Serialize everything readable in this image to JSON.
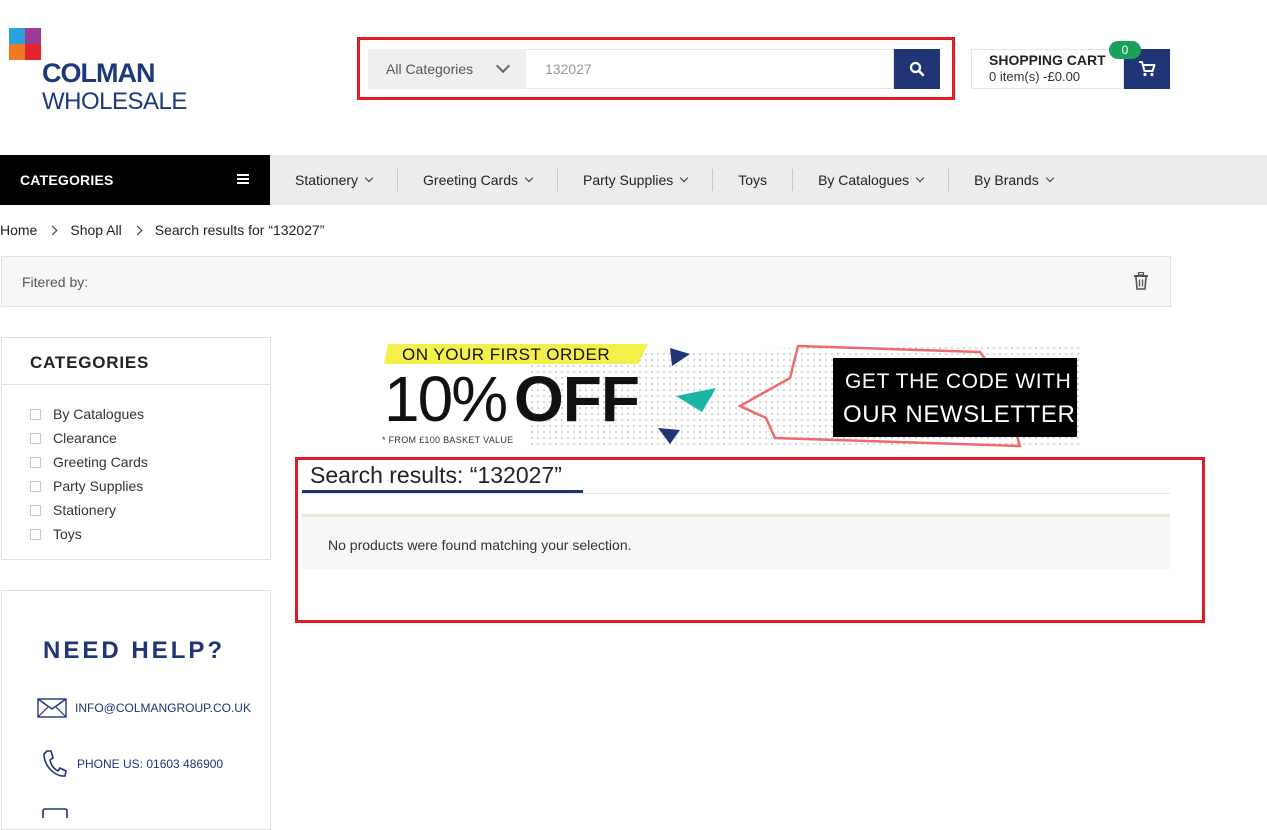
{
  "brand": {
    "line1": "COLMAN",
    "line2": "WHOLESALE",
    "colors": [
      "#2aa3dc",
      "#9b3d97",
      "#f07a21",
      "#e3262e",
      "#1c3a7a"
    ]
  },
  "search": {
    "category_selected": "All Categories",
    "query": "132027",
    "button_icon": "search-icon"
  },
  "cart": {
    "title": "SHOPPING CART",
    "summary": "0 item(s) -£0.00",
    "count": "0",
    "icon": "cart-icon"
  },
  "nav": {
    "categories_label": "CATEGORIES",
    "items": [
      {
        "label": "Stationery",
        "dropdown": true
      },
      {
        "label": "Greeting Cards",
        "dropdown": true
      },
      {
        "label": "Party Supplies",
        "dropdown": true
      },
      {
        "label": "Toys",
        "dropdown": false
      },
      {
        "label": "By Catalogues",
        "dropdown": true
      },
      {
        "label": "By Brands",
        "dropdown": true
      }
    ]
  },
  "breadcrumb": [
    "Home",
    "Shop All",
    "Search results for “132027”"
  ],
  "filter": {
    "label": "Fitered by:"
  },
  "sidebar": {
    "categories_title": "CATEGORIES",
    "categories": [
      "By Catalogues",
      "Clearance",
      "Greeting Cards",
      "Party Supplies",
      "Stationery",
      "Toys"
    ],
    "help_title": "NEED HELP?",
    "email": "INFO@COLMANGROUP.CO.UK",
    "phone": "PHONE US: 01603 486900"
  },
  "banner": {
    "tag": "ON YOUR FIRST ORDER",
    "offer_num": "10%",
    "offer_word": "OFF",
    "footnote": "* FROM £100 BASKET VALUE",
    "cta_line1": "GET THE CODE WITH",
    "cta_line2": "OUR NEWSLETTER"
  },
  "results": {
    "title": "Search results: “132027”",
    "message": "No products were found matching your selection."
  },
  "colors": {
    "navy": "#1f3576",
    "highlight_red": "#e01b24",
    "cart_badge": "#1aa15a",
    "banner_yellow": "#f5ef4a",
    "banner_teal": "#1bb5a6",
    "banner_coral": "#ef6b6b"
  }
}
